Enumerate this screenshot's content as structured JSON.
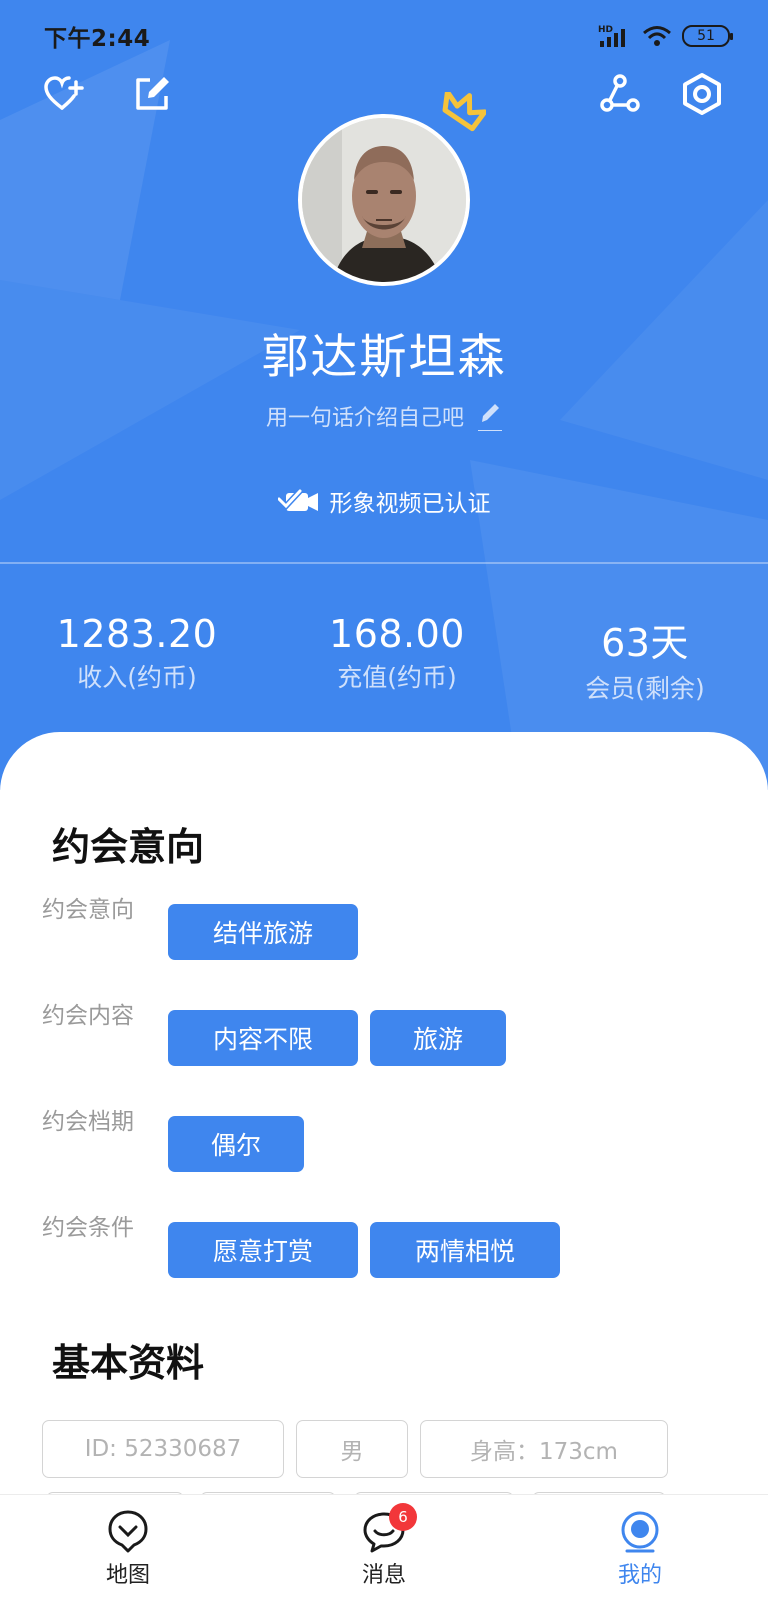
{
  "status_bar": {
    "time": "下午2:44",
    "signal_label": "HD",
    "battery": "51"
  },
  "header": {
    "icons": [
      "heart-plus-icon",
      "edit-icon",
      "share-icon",
      "settings-icon"
    ],
    "profile": {
      "name": "郭达斯坦森",
      "bio_placeholder": "用一句话介绍自己吧",
      "verified_text": "形象视频已认证"
    },
    "stats": [
      {
        "value": "1283.20",
        "label": "收入(约币)"
      },
      {
        "value": "168.00",
        "label": "充值(约币)"
      },
      {
        "value": "63天",
        "label": "会员(剩余)"
      }
    ]
  },
  "dating": {
    "title": "约会意向",
    "rows": [
      {
        "label": "约会意向",
        "chips": [
          "结伴旅游"
        ]
      },
      {
        "label": "约会内容",
        "chips": [
          "内容不限",
          "旅游"
        ]
      },
      {
        "label": "约会档期",
        "chips": [
          "偶尔"
        ]
      },
      {
        "label": "约会条件",
        "chips": [
          "愿意打赏",
          "两情相悦"
        ]
      }
    ]
  },
  "basic_info": {
    "title": "基本资料",
    "fields": [
      "ID: 52330687",
      "男",
      "身高：173cm"
    ]
  },
  "bottom_nav": {
    "items": [
      {
        "label": "地图",
        "icon": "map-pin-icon"
      },
      {
        "label": "消息",
        "icon": "chat-icon",
        "badge": "6"
      },
      {
        "label": "我的",
        "icon": "profile-icon",
        "active": true
      }
    ]
  },
  "colors": {
    "primary": "#3f86ee",
    "badge": "#f2373a",
    "label_gray": "#9a9a9a"
  }
}
